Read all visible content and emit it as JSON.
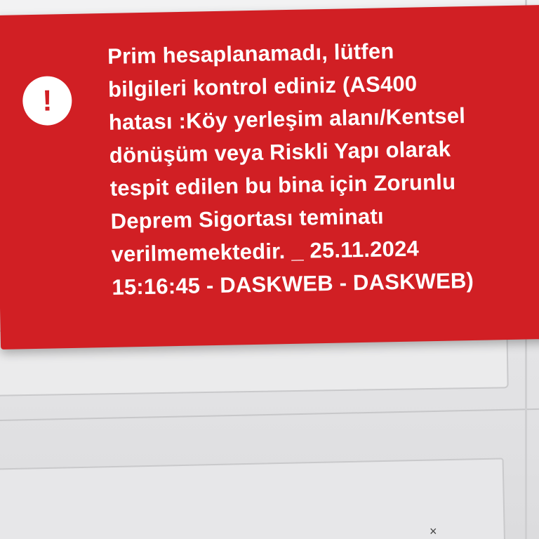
{
  "background": {
    "close_glyph": "×"
  },
  "toast": {
    "type": "error",
    "accent_color": "#d11f24",
    "icon": {
      "name": "exclamation-icon",
      "glyph": "!"
    },
    "message_lines": [
      "Prim hesaplanamadı, lütfen",
      "bilgileri kontrol ediniz (AS400",
      "hatası :Köy yerleşim alanı/Kentsel",
      "dönüşüm veya Riskli Yapı olarak",
      "tespit edilen bu bina için Zorunlu",
      "Deprem Sigortası teminatı",
      "verilmemektedir. _ 25.11.2024",
      "15:16:45 - DASKWEB - DASKWEB)"
    ]
  }
}
